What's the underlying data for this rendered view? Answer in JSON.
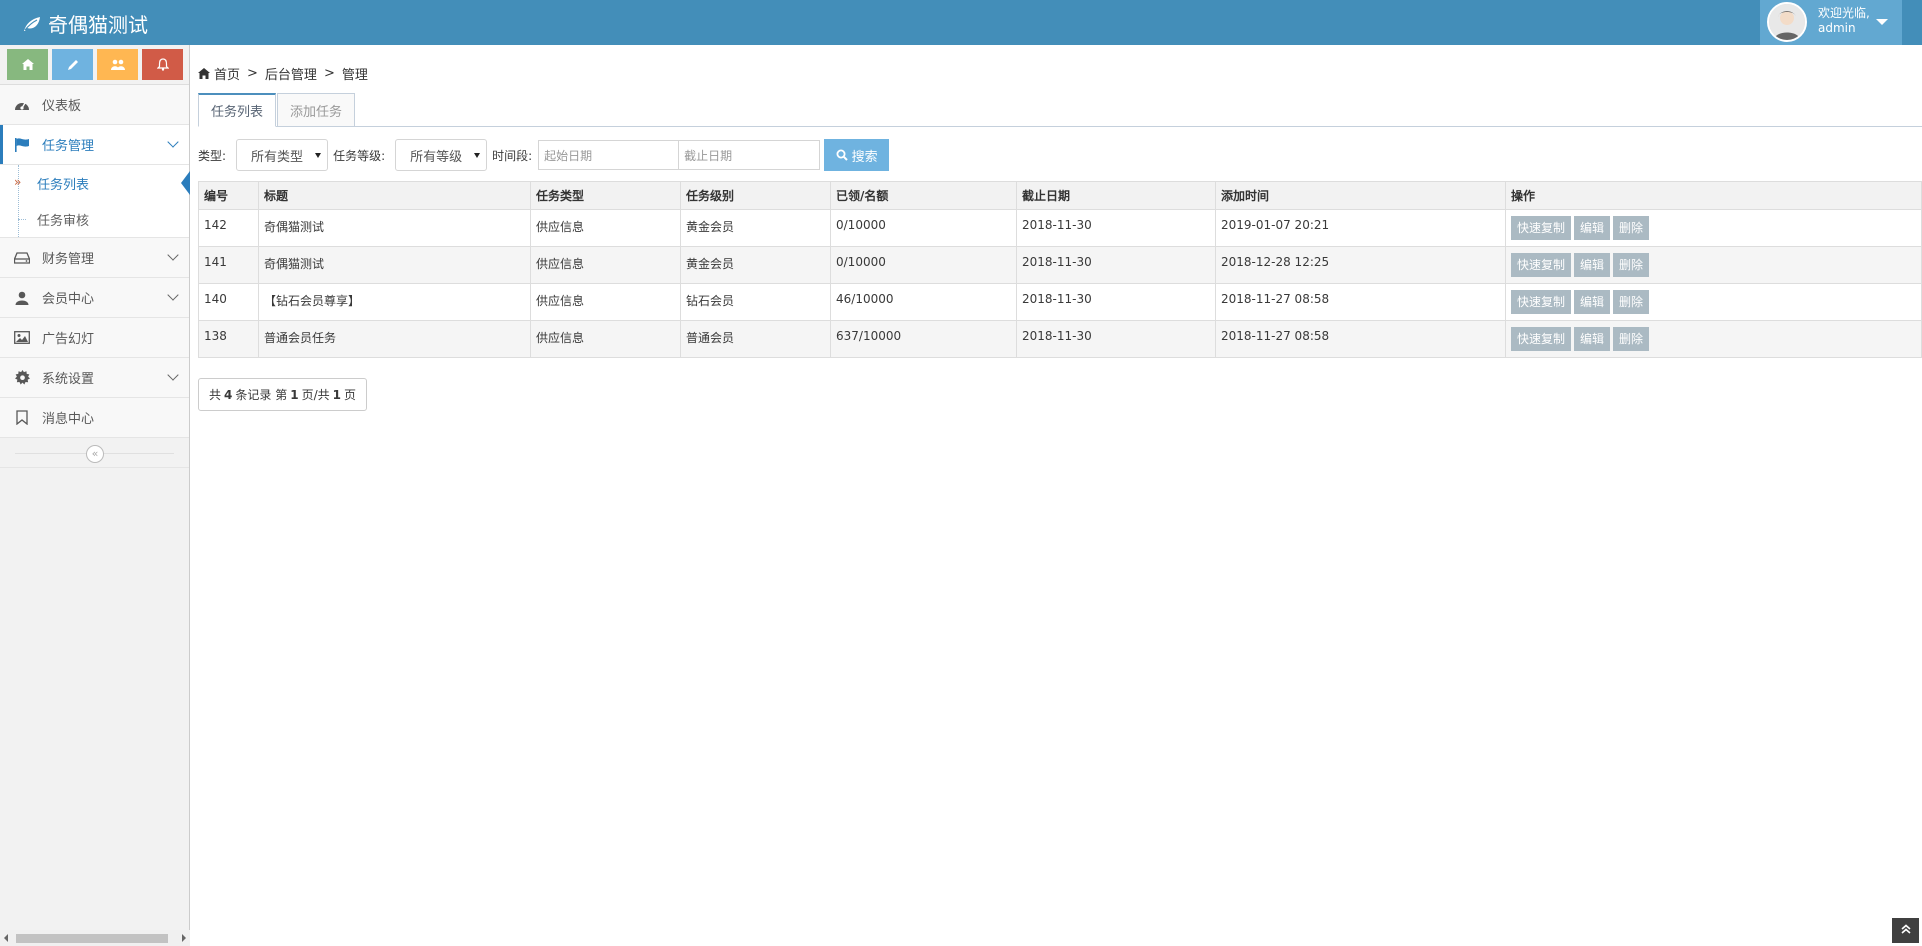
{
  "app": {
    "title": "奇偶猫测试"
  },
  "user": {
    "greeting": "欢迎光临,",
    "name": "admin"
  },
  "shortcut_colors": [
    "#87b87f",
    "#6fb3e0",
    "#ffb752",
    "#d15b47"
  ],
  "sidebar": {
    "items": [
      {
        "label": "仪表板",
        "icon": "dashboard-icon"
      },
      {
        "label": "任务管理",
        "icon": "flag-icon"
      },
      {
        "label": "财务管理",
        "icon": "drive-icon"
      },
      {
        "label": "会员中心",
        "icon": "user-icon"
      },
      {
        "label": "广告幻灯",
        "icon": "picture-icon"
      },
      {
        "label": "系统设置",
        "icon": "gear-icon"
      },
      {
        "label": "消息中心",
        "icon": "bookmark-icon"
      }
    ],
    "task_submenu": [
      {
        "label": "任务列表"
      },
      {
        "label": "任务审核"
      }
    ]
  },
  "breadcrumb": {
    "home": "首页",
    "sep1": ">",
    "level2": "后台管理",
    "sep2": ">",
    "level3": "管理"
  },
  "tabs": [
    {
      "label": "任务列表"
    },
    {
      "label": "添加任务"
    }
  ],
  "filter": {
    "type_label": "类型:",
    "type_value": "所有类型",
    "level_label": "任务等级:",
    "level_value": "所有等级",
    "period_label": "时间段:",
    "start_placeholder": "起始日期",
    "end_placeholder": "截止日期",
    "search_label": "搜索"
  },
  "table": {
    "headers": [
      "编号",
      "标题",
      "任务类型",
      "任务级别",
      "已领/名额",
      "截止日期",
      "添加时间",
      "操作"
    ],
    "rows": [
      {
        "id": "142",
        "title": "奇偶猫测试",
        "type": "供应信息",
        "level": "黄金会员",
        "quota": "0/10000",
        "deadline": "2018-11-30",
        "added": "2019-01-07 20:21"
      },
      {
        "id": "141",
        "title": "奇偶猫测试",
        "type": "供应信息",
        "level": "黄金会员",
        "quota": "0/10000",
        "deadline": "2018-11-30",
        "added": "2018-12-28 12:25"
      },
      {
        "id": "140",
        "title": "【钻石会员尊享】",
        "type": "供应信息",
        "level": "钻石会员",
        "quota": "46/10000",
        "deadline": "2018-11-30",
        "added": "2018-11-27 08:58"
      },
      {
        "id": "138",
        "title": "普通会员任务",
        "type": "供应信息",
        "level": "普通会员",
        "quota": "637/10000",
        "deadline": "2018-11-30",
        "added": "2018-11-27 08:58"
      }
    ],
    "actions": {
      "copy": "快速复制",
      "edit": "编辑",
      "delete": "删除"
    }
  },
  "pager": {
    "prefix": "共",
    "total": "4",
    "mid": "条记录 第",
    "page": "1",
    "mid2": "页/共",
    "pages": "1",
    "suffix": "页"
  }
}
